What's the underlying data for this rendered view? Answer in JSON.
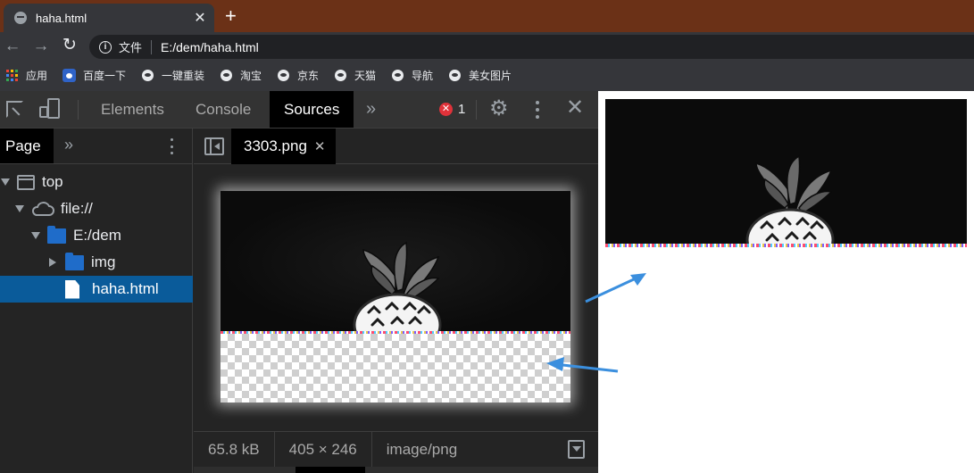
{
  "browser": {
    "tab": {
      "title": "haha.html",
      "close": "✕"
    },
    "new_tab": "+",
    "address": {
      "scheme_label": "文件",
      "url": "E:/dem/haha.html"
    },
    "bookmarks": [
      {
        "label": "应用",
        "icon": "apps-grid-icon"
      },
      {
        "label": "百度一下",
        "icon": "baidu-paw-icon"
      },
      {
        "label": "一键重装",
        "icon": "globe-icon"
      },
      {
        "label": "淘宝",
        "icon": "globe-icon"
      },
      {
        "label": "京东",
        "icon": "globe-icon"
      },
      {
        "label": "天猫",
        "icon": "globe-icon"
      },
      {
        "label": "导航",
        "icon": "globe-icon"
      },
      {
        "label": "美女图片",
        "icon": "globe-icon"
      }
    ]
  },
  "devtools": {
    "tabs": [
      "Elements",
      "Console",
      "Sources"
    ],
    "active_tab": "Sources",
    "more_tabs": "»",
    "error_count": "1",
    "navigator": {
      "tab": "Page",
      "more": "»",
      "tree": [
        {
          "label": "top",
          "icon": "frame-icon",
          "expanded": true
        },
        {
          "label": "file://",
          "icon": "cloud-icon",
          "expanded": true
        },
        {
          "label": "E:/dem",
          "icon": "folder-icon",
          "expanded": true
        },
        {
          "label": "img",
          "icon": "folder-icon",
          "expanded": false
        },
        {
          "label": "haha.html",
          "icon": "file-icon",
          "selected": true
        }
      ]
    },
    "editor": {
      "open_file": "3303.png",
      "close": "✕",
      "status": {
        "size": "65.8 kB",
        "dimensions": "405 × 246",
        "mime": "image/png"
      }
    }
  },
  "colors": {
    "tabstrip": "#6b3117",
    "toolbar": "#35363a",
    "devtools_bg": "#242424",
    "selection": "#0a5b9a",
    "arrow": "#3b8fde"
  }
}
